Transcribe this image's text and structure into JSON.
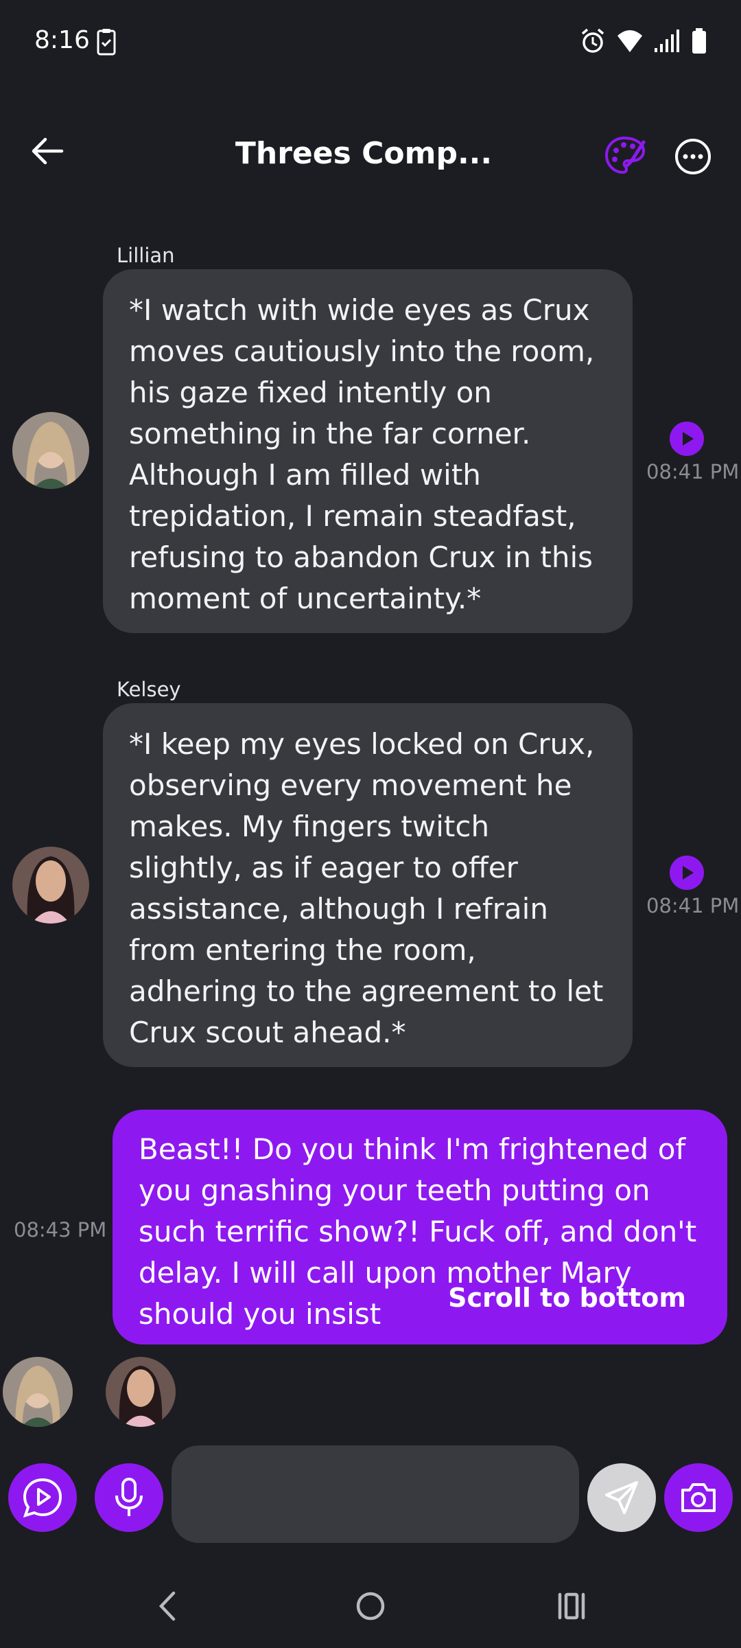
{
  "status_bar": {
    "time": "8:16"
  },
  "header": {
    "title": "Threes Comp..."
  },
  "messages": [
    {
      "sender": "Lillian",
      "text": "*I watch with wide eyes as Crux moves cautiously into the room, his gaze fixed intently on something in the far corner. Although I am filled with trepidation, I remain steadfast, refusing to abandon Crux in this moment of uncertainty.*",
      "time": "08:41 PM"
    },
    {
      "sender": "Kelsey",
      "text": "*I keep my eyes locked on Crux, observing every movement he makes. My fingers twitch slightly, as if eager to offer assistance, although I refrain from entering the room, adhering to the agreement to let Crux scout ahead.*",
      "time": "08:41 PM"
    },
    {
      "sender": "",
      "text": "Beast!! Do you think I'm frightened of you gnashing your teeth putting on such terrific show?! Fuck off, and don't delay. I will call upon mother Mary should you insist",
      "time": "08:43 PM"
    }
  ],
  "scroll_to_bottom_label": "Scroll to bottom",
  "input": {
    "placeholder": ""
  },
  "colors": {
    "accent": "#8e19f0",
    "background": "#1c1d22",
    "bubble": "#383a40"
  },
  "icons": [
    "back-arrow-icon",
    "palette-icon",
    "more-icon",
    "play-icon",
    "chat-play-icon",
    "microphone-icon",
    "send-icon",
    "camera-icon"
  ]
}
